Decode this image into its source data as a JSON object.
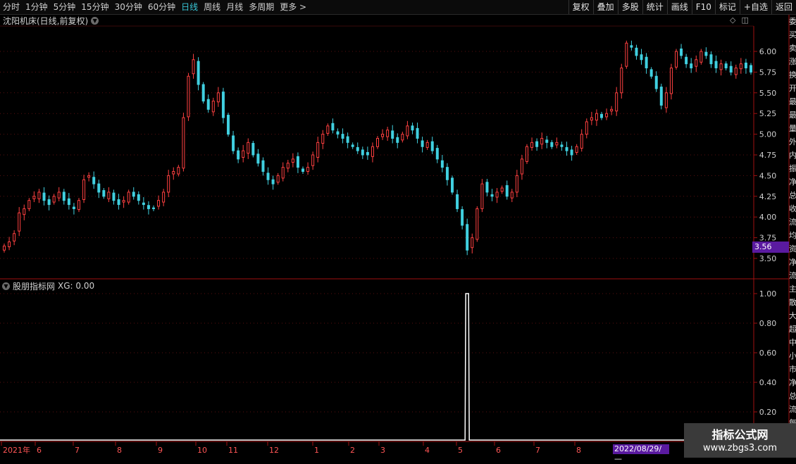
{
  "toolbar": {
    "periods": [
      "分时",
      "1分钟",
      "5分钟",
      "15分钟",
      "30分钟",
      "60分钟",
      "日线",
      "周线",
      "月线",
      "多周期",
      "更多 >"
    ],
    "active_index": 6,
    "actions": [
      "复权",
      "叠加",
      "多股",
      "统计",
      "画线",
      "F10",
      "标记",
      "+自选",
      "返回"
    ]
  },
  "main_chart": {
    "title": "沈阳机床(日线,前复权)",
    "last_price_tag": "3.56",
    "y_ticks": [
      "6.00",
      "5.75",
      "5.50",
      "5.25",
      "5.00",
      "4.75",
      "4.50",
      "4.25",
      "4.00",
      "3.75",
      "3.50"
    ],
    "up_color": "#ff4040",
    "down_color": "#40d0e0"
  },
  "indicator": {
    "title": "股朋指标网",
    "value_text": "XG: 0.00",
    "y_ticks": [
      "1.00",
      "0.80",
      "0.60",
      "0.40",
      "0.20"
    ]
  },
  "x_axis": {
    "labels": [
      "2021年",
      "6",
      "7",
      "8",
      "9",
      "10",
      "11",
      "12",
      "1",
      "2",
      "3",
      "4",
      "5",
      "6",
      "7",
      "8"
    ],
    "cursor_date": "2022/08/29/—"
  },
  "right_strip": [
    "委",
    "买",
    "卖",
    "涨",
    "换",
    "开",
    "最",
    "最",
    "量",
    "外",
    "内",
    "振",
    "净",
    "总",
    "收",
    "流",
    "均",
    "资",
    "净",
    "流",
    "主",
    "散",
    "大",
    "超",
    "中",
    "小",
    "市",
    "净",
    "总",
    "流",
    "每",
    "净"
  ],
  "watermark": {
    "line1": "指标公式网",
    "line2": "www.zbgs3.com"
  },
  "chart_data": [
    {
      "type": "candlestick",
      "title": "沈阳机床(日线,前复权)",
      "y_ticks": [
        6.0,
        5.75,
        5.5,
        5.25,
        5.0,
        4.75,
        4.5,
        4.25,
        4.0,
        3.75,
        3.5
      ],
      "x_months": [
        "2021年",
        "6",
        "7",
        "8",
        "9",
        "10",
        "11",
        "12",
        "1",
        "2",
        "3",
        "4",
        "5",
        "6",
        "7",
        "8"
      ],
      "last_price": 3.56,
      "close": [
        3.65,
        3.7,
        3.8,
        4.05,
        4.1,
        4.2,
        4.25,
        4.3,
        4.2,
        4.15,
        4.25,
        4.3,
        4.2,
        4.15,
        4.1,
        4.2,
        4.45,
        4.5,
        4.4,
        4.3,
        4.25,
        4.3,
        4.2,
        4.15,
        4.2,
        4.3,
        4.25,
        4.2,
        4.15,
        4.1,
        4.1,
        4.2,
        4.3,
        4.5,
        4.55,
        4.6,
        5.2,
        5.7,
        5.9,
        5.6,
        5.4,
        5.3,
        5.4,
        5.5,
        5.2,
        5.0,
        4.8,
        4.7,
        4.8,
        4.9,
        4.75,
        4.65,
        4.55,
        4.45,
        4.4,
        4.5,
        4.6,
        4.65,
        4.7,
        4.6,
        4.55,
        4.6,
        4.75,
        4.9,
        5.0,
        5.1,
        5.05,
        5.0,
        4.95,
        4.9,
        4.85,
        4.8,
        4.75,
        4.75,
        4.85,
        4.95,
        5.0,
        5.05,
        4.95,
        4.9,
        5.0,
        5.1,
        5.05,
        4.95,
        4.85,
        4.9,
        4.8,
        4.7,
        4.6,
        4.45,
        4.3,
        4.1,
        3.9,
        3.6,
        3.75,
        4.1,
        4.4,
        4.3,
        4.25,
        4.3,
        4.35,
        4.25,
        4.3,
        4.5,
        4.7,
        4.85,
        4.9,
        4.85,
        4.95,
        4.9,
        4.85,
        4.9,
        4.85,
        4.8,
        4.75,
        4.85,
        5.0,
        5.15,
        5.2,
        5.25,
        5.2,
        5.25,
        5.3,
        5.5,
        5.8,
        6.1,
        6.05,
        5.95,
        5.9,
        5.8,
        5.7,
        5.55,
        5.35,
        5.5,
        5.8,
        6.0,
        5.95,
        5.85,
        5.8,
        5.9,
        6.0,
        5.95,
        5.85,
        5.8,
        5.85,
        5.8,
        5.75,
        5.8,
        5.85,
        5.8,
        5.75
      ]
    },
    {
      "type": "line",
      "title": "股朋指标网",
      "series": [
        {
          "name": "XG",
          "signal_at_index": 93,
          "signal_value": 1.0,
          "baseline": 0.0
        }
      ],
      "y_ticks": [
        1.0,
        0.8,
        0.6,
        0.4,
        0.2
      ]
    }
  ]
}
